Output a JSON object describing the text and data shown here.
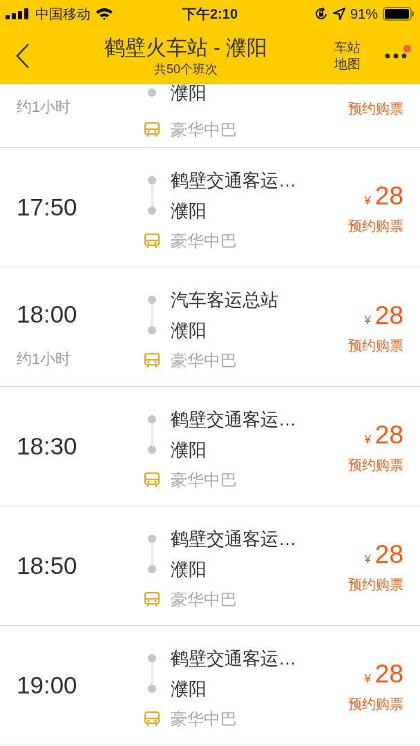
{
  "status_bar": {
    "carrier": "中国移动",
    "time": "下午2:10",
    "battery": "91%"
  },
  "header": {
    "title": "鹤壁火车站 - 濮阳",
    "subtitle": "共50个班次",
    "map_button": "车站地图",
    "has_notification": true
  },
  "trips": [
    {
      "kind": "partial",
      "duration": "约1小时",
      "destination": "濮阳",
      "bus_type": "豪华中巴",
      "action": "预约购票"
    },
    {
      "kind": "full",
      "time": "17:50",
      "origin": "鹤壁交通客运…",
      "destination": "濮阳",
      "bus_type": "豪华中巴",
      "currency": "¥",
      "price": "28",
      "action": "预约购票"
    },
    {
      "kind": "full",
      "time": "18:00",
      "duration": "约1小时",
      "origin": "汽车客运总站",
      "destination": "濮阳",
      "bus_type": "豪华中巴",
      "currency": "¥",
      "price": "28",
      "action": "预约购票"
    },
    {
      "kind": "full",
      "time": "18:30",
      "origin": "鹤壁交通客运…",
      "destination": "濮阳",
      "bus_type": "豪华中巴",
      "currency": "¥",
      "price": "28",
      "action": "预约购票"
    },
    {
      "kind": "full",
      "time": "18:50",
      "origin": "鹤壁交通客运…",
      "destination": "濮阳",
      "bus_type": "豪华中巴",
      "currency": "¥",
      "price": "28",
      "action": "预约购票"
    },
    {
      "kind": "full",
      "time": "19:00",
      "origin": "鹤壁交通客运…",
      "destination": "濮阳",
      "bus_type": "豪华中巴",
      "currency": "¥",
      "price": "28",
      "action": "预约购票"
    }
  ]
}
